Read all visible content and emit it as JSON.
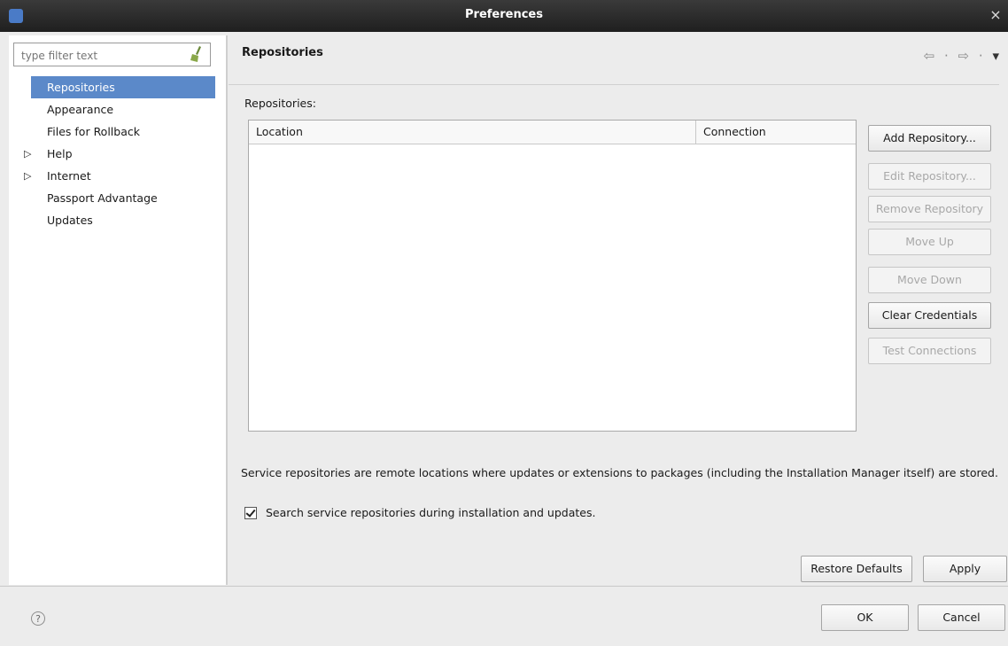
{
  "window": {
    "title": "Preferences",
    "close_glyph": "×"
  },
  "filter": {
    "placeholder": "type filter text"
  },
  "tree": {
    "items": [
      {
        "label": "Repositories",
        "selected": true,
        "expandable": false
      },
      {
        "label": "Appearance",
        "expandable": false
      },
      {
        "label": "Files for Rollback",
        "expandable": false
      },
      {
        "label": "Help",
        "expandable": true
      },
      {
        "label": "Internet",
        "expandable": true
      },
      {
        "label": "Passport Advantage",
        "expandable": false
      },
      {
        "label": "Updates",
        "expandable": false
      }
    ]
  },
  "page": {
    "title": "Repositories",
    "nav": {
      "back": "⇦",
      "dot1": "·",
      "forward": "⇨",
      "dot2": "·",
      "menu": "▾"
    },
    "repositories_label": "Repositories:",
    "table": {
      "columns": [
        "Location",
        "Connection"
      ]
    },
    "side_buttons": [
      {
        "label": "Add Repository...",
        "enabled": true
      },
      {
        "label": "Edit Repository...",
        "enabled": false
      },
      {
        "label": "Remove Repository",
        "enabled": false
      },
      {
        "label": "Move Up",
        "enabled": false
      },
      {
        "label": "Move Down",
        "enabled": false
      },
      {
        "label": "Clear Credentials",
        "enabled": true
      },
      {
        "label": "Test Connections",
        "enabled": false
      }
    ],
    "description": "Service repositories are remote locations where updates or extensions to packages (including the Installation Manager itself) are stored.",
    "checkbox": {
      "label": "Search service repositories during installation and updates.",
      "checked": true
    },
    "restore_defaults": "Restore Defaults",
    "apply": "Apply"
  },
  "footer": {
    "help_glyph": "?",
    "ok": "OK",
    "cancel": "Cancel"
  },
  "colors": {
    "selection": "#5b89c9",
    "titlebar": "#2a2a2a"
  }
}
